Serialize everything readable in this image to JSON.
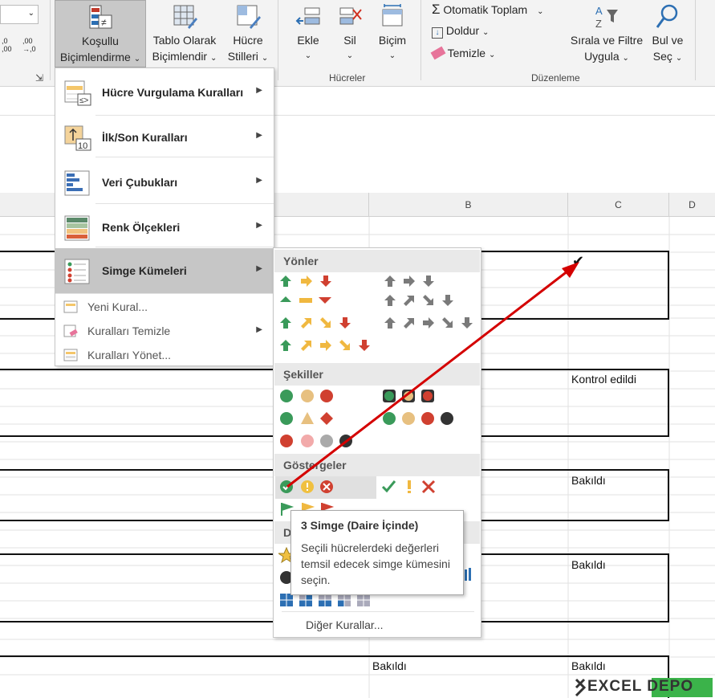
{
  "ribbon": {
    "conditional_formatting": {
      "line1": "Koşullu",
      "line2": "Biçimlendirme"
    },
    "format_as_table": {
      "line1": "Tablo Olarak",
      "line2": "Biçimlendir"
    },
    "cell_styles": {
      "line1": "Hücre",
      "line2": "Stilleri"
    },
    "insert": "Ekle",
    "delete": "Sil",
    "format": "Biçim",
    "cells_group": "Hücreler",
    "autosum": "Otomatik Toplam",
    "fill": "Doldur",
    "clear": "Temizle",
    "sort_filter": {
      "line1": "Sırala ve Filtre",
      "line2": "Uygula"
    },
    "find_select": {
      "line1": "Bul ve",
      "line2": "Seç"
    },
    "editing_group": "Düzenleme",
    "number_fmt_left": ",00\n→,0",
    "number_fmt_right": ",00\n→,0"
  },
  "menu": {
    "items": [
      {
        "label": "Hücre Vurgulama Kuralları",
        "icon": "highlight-cells-icon"
      },
      {
        "label": "İlk/Son Kuralları",
        "icon": "top-bottom-icon"
      },
      {
        "label": "Veri Çubukları",
        "icon": "data-bars-icon"
      },
      {
        "label": "Renk Ölçekleri",
        "icon": "color-scales-icon"
      },
      {
        "label": "Simge Kümeleri",
        "icon": "icon-sets-icon"
      }
    ],
    "small_items": [
      {
        "label": "Yeni Kural..."
      },
      {
        "label": "Kuralları Temizle"
      },
      {
        "label": "Kuralları Yönet..."
      }
    ]
  },
  "submenu": {
    "directions": "Yönler",
    "shapes": "Şekiller",
    "indicators": "Göstergeler",
    "ratings_partial": "D",
    "more_rules": "Diğer Kurallar..."
  },
  "tooltip": {
    "title": "3 Simge (Daire İçinde)",
    "body": "Seçili hücrelerdeki değerleri temsil edecek simge kümesini seçin."
  },
  "sheet": {
    "columns": [
      "B",
      "C",
      "D"
    ],
    "cells": {
      "c_kontrol": "Kontrol edildi",
      "c_bakildi1": "Bakıldı",
      "c_bakildi2": "Bakıldı",
      "b_bakildi": "Bakıldı",
      "c_bakildi3": "Bakıldı",
      "c_check": "✔"
    }
  },
  "logo": {
    "text": "EXCEL DEPO"
  },
  "colors": {
    "red_arrow": "#d40000",
    "green": "#3a9a5a",
    "yellow": "#f0c040",
    "red": "#d04030",
    "gray": "#7a7a7a"
  }
}
